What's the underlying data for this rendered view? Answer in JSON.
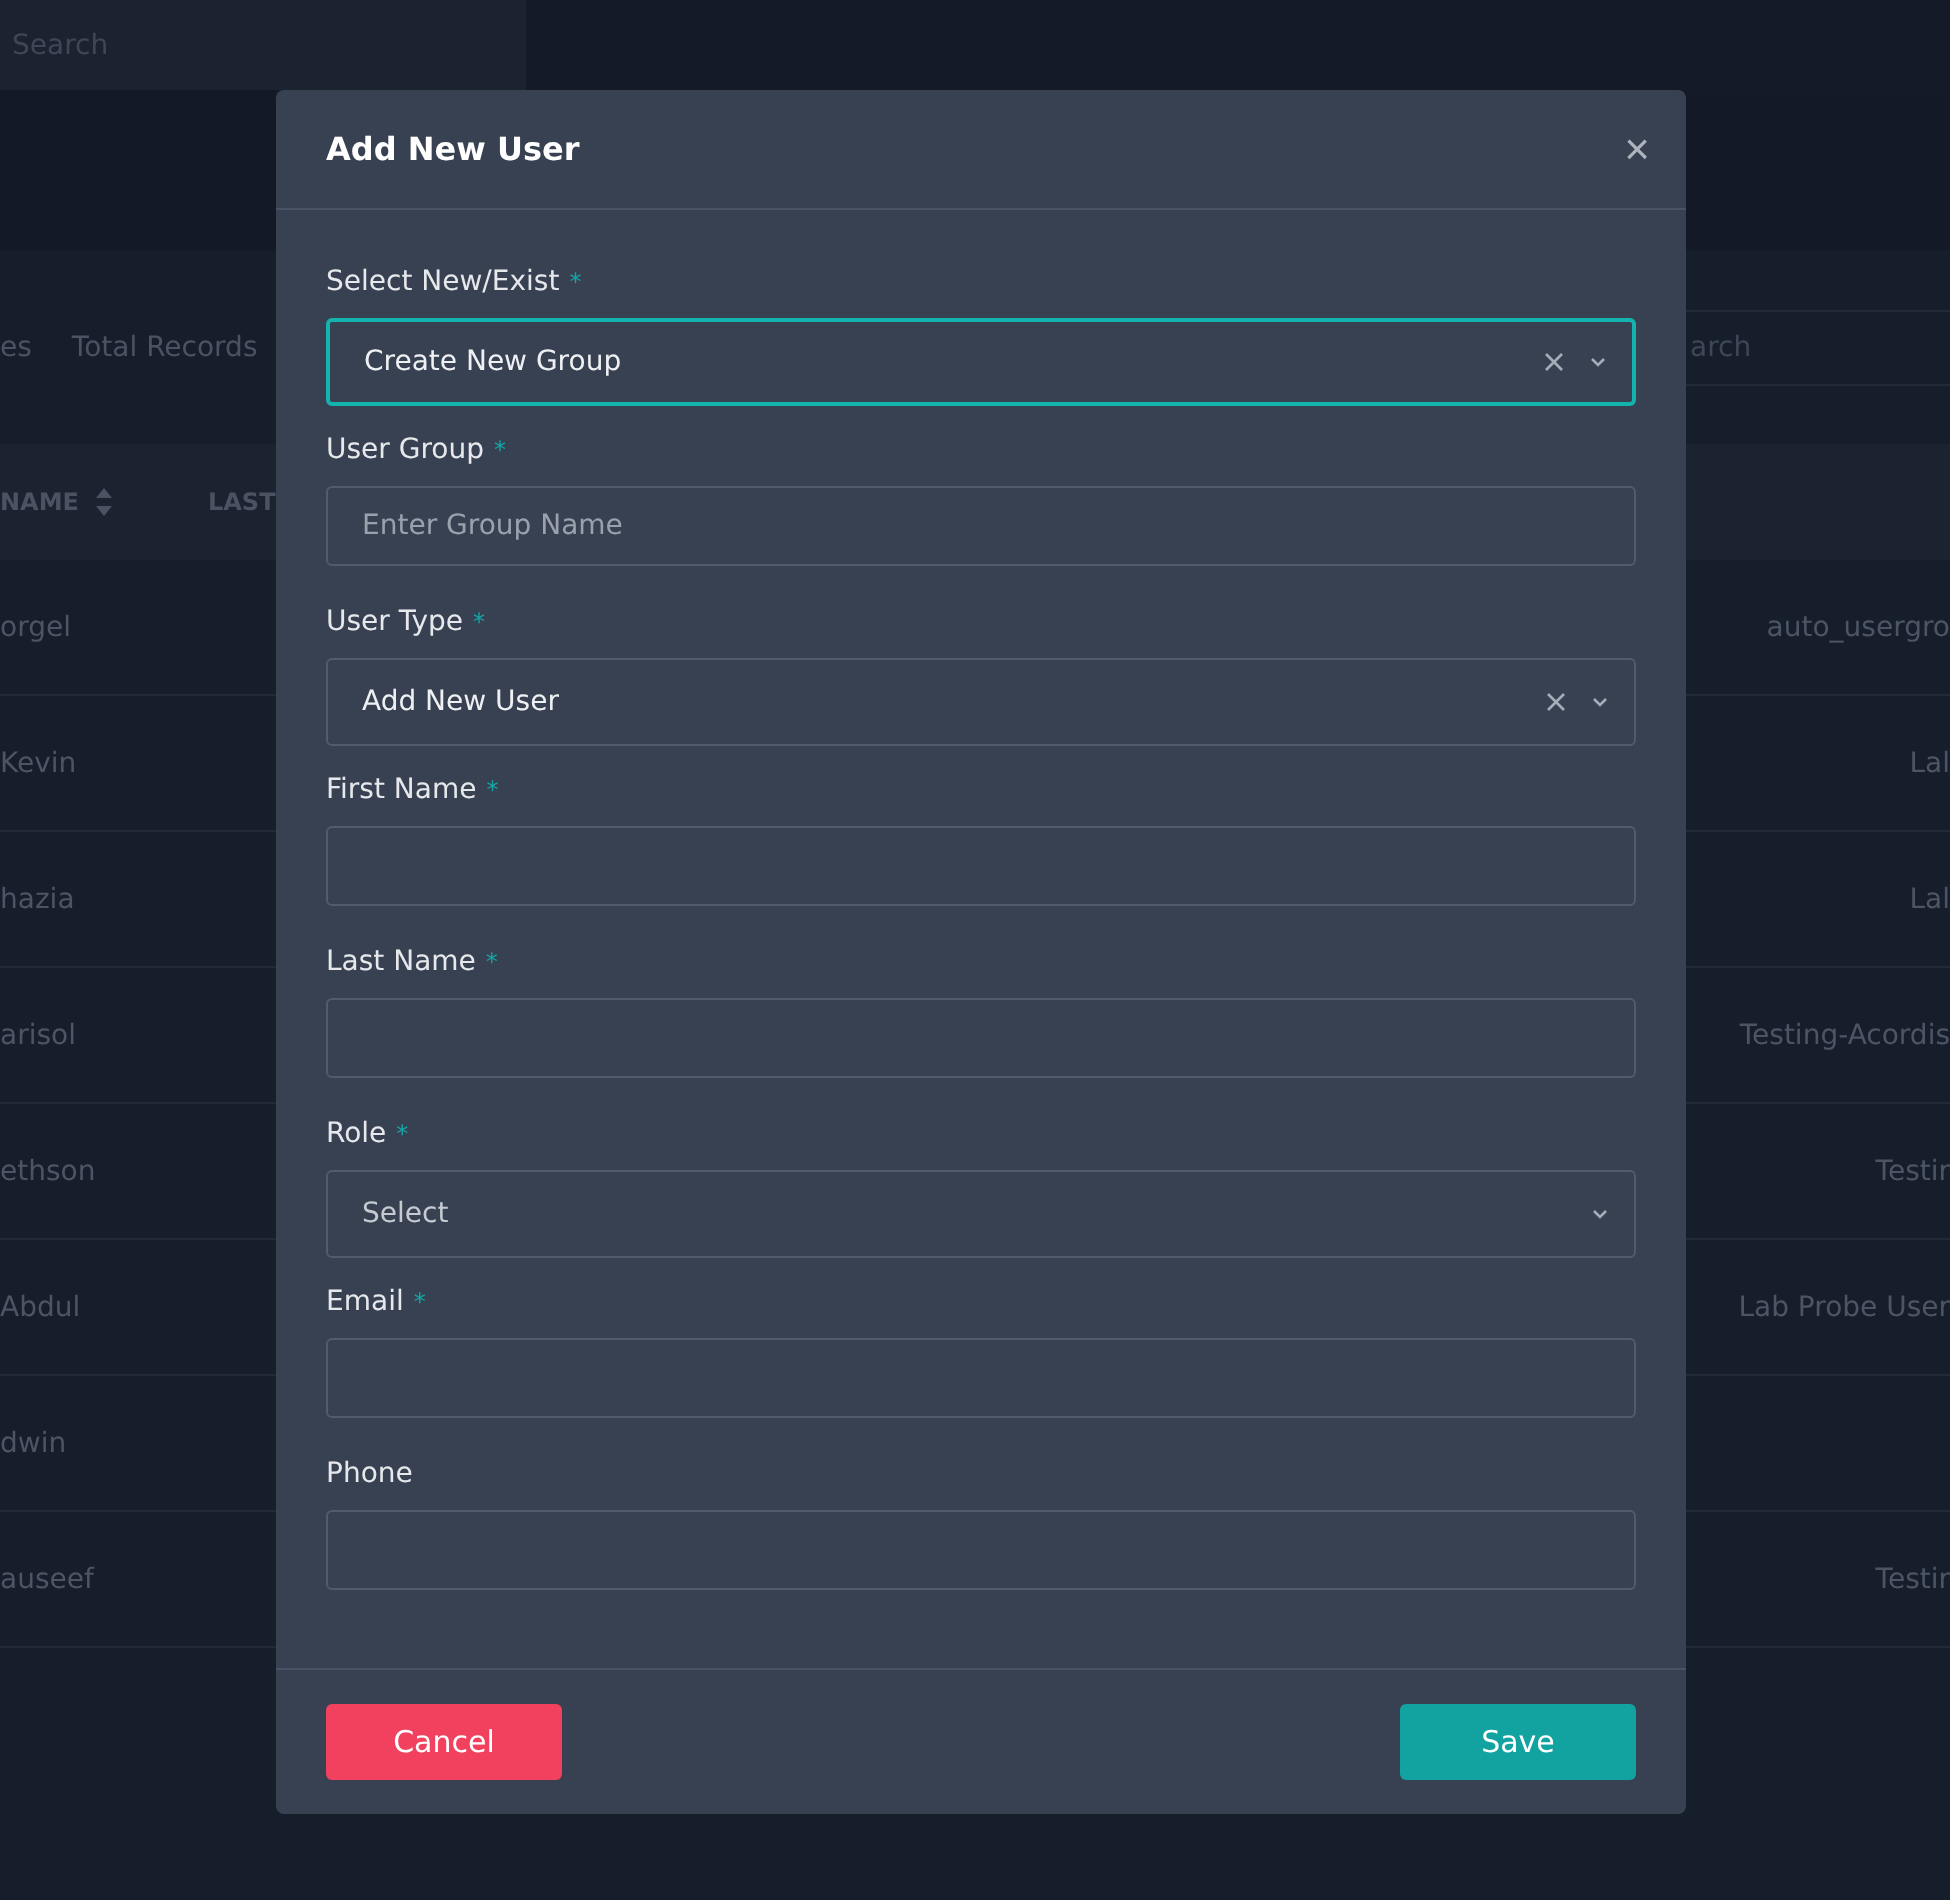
{
  "page": {
    "search": {
      "placeholder": "Search"
    },
    "toolbar": {
      "left_text": "es",
      "total_records": "Total Records",
      "search_placeholder": "arch"
    },
    "table": {
      "columns": [
        {
          "label": "NAME",
          "sortable": true
        },
        {
          "label": "LAST",
          "sortable": false
        }
      ],
      "rows": [
        {
          "first_name": "orgel",
          "group": "auto_usergro"
        },
        {
          "first_name": "Kevin",
          "group": "Lal"
        },
        {
          "first_name": "hazia",
          "group": "Lal"
        },
        {
          "first_name": "arisol",
          "group": "Testing-Acordis"
        },
        {
          "first_name": "ethson",
          "group": "Testir"
        },
        {
          "first_name": "Abdul",
          "group": "Lab Probe User"
        },
        {
          "first_name": "dwin",
          "group": ""
        },
        {
          "first_name": "auseef",
          "group": "Testir"
        }
      ]
    }
  },
  "dialog": {
    "title": "Add New User",
    "close": "×",
    "fields": [
      {
        "kind": "select",
        "label": "Select New/Exist",
        "required_mark": "*",
        "value": "Create New Group",
        "clearable": true,
        "focused": true
      },
      {
        "kind": "text",
        "label": "User Group",
        "required_mark": "*",
        "placeholder": "Enter Group Name",
        "focused": false
      },
      {
        "kind": "select",
        "label": "User Type",
        "required_mark": "*",
        "value": "Add New User",
        "clearable": true,
        "focused": false
      },
      {
        "kind": "text",
        "label": "First Name",
        "required_mark": "*",
        "focused": false
      },
      {
        "kind": "text",
        "label": "Last Name",
        "required_mark": "*",
        "focused": false
      },
      {
        "kind": "select",
        "label": "Role",
        "required_mark": "*",
        "placeholder": "Select",
        "clearable": false,
        "focused": false
      },
      {
        "kind": "text",
        "label": "Email",
        "required_mark": "*",
        "focused": false
      },
      {
        "kind": "text",
        "label": "Phone",
        "focused": false
      }
    ],
    "buttons": [
      {
        "kind": "cancel",
        "label": "Cancel"
      },
      {
        "kind": "primary",
        "label": "Save"
      }
    ]
  }
}
